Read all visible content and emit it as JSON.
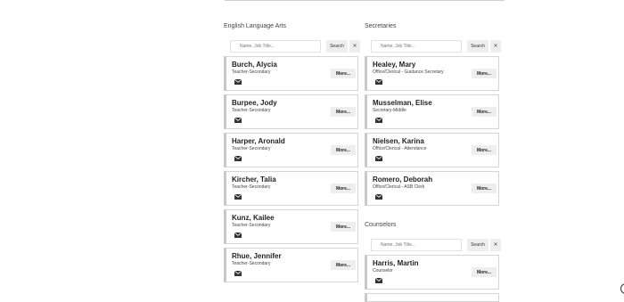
{
  "english": {
    "title": "English Language Arts",
    "search": {
      "placeholder": "Name, Job Title...",
      "button": "Search",
      "clear": "×"
    },
    "people": [
      {
        "name": "Burch, Alycia",
        "title": "Teacher-Secondary",
        "more": "More..."
      },
      {
        "name": "Burpee, Jody",
        "title": "Teacher-Secondary",
        "more": "More..."
      },
      {
        "name": "Harper, Aronald",
        "title": "Teacher-Secondary",
        "more": "More..."
      },
      {
        "name": "Kircher, Talia",
        "title": "Teacher-Secondary",
        "more": "More..."
      },
      {
        "name": "Kunz, Kailee",
        "title": "Teacher-Secondary",
        "more": "More..."
      },
      {
        "name": "Rhue, Jennifer",
        "title": "Teacher-Secondary",
        "more": "More..."
      }
    ]
  },
  "secretaries": {
    "title": "Secretaries",
    "search": {
      "placeholder": "Name, Job Title...",
      "button": "Search",
      "clear": "×"
    },
    "people": [
      {
        "name": "Healey, Mary",
        "title": "Office/Clerical - Guidance Secretary",
        "more": "More..."
      },
      {
        "name": "Musselman, Elise",
        "title": "Secretary-Middle",
        "more": "More..."
      },
      {
        "name": "Nielsen, Karina",
        "title": "Office/Clerical - Attendance",
        "more": "More..."
      },
      {
        "name": "Romero, Deborah",
        "title": "Office/Clerical - ASB Clerk",
        "more": "More..."
      }
    ]
  },
  "counselors": {
    "title": "Counselors",
    "search": {
      "placeholder": "Name, Job Title...",
      "button": "Search",
      "clear": "×"
    },
    "people": [
      {
        "name": "Harris, Martin",
        "title": "Counselor",
        "more": "More..."
      }
    ]
  }
}
